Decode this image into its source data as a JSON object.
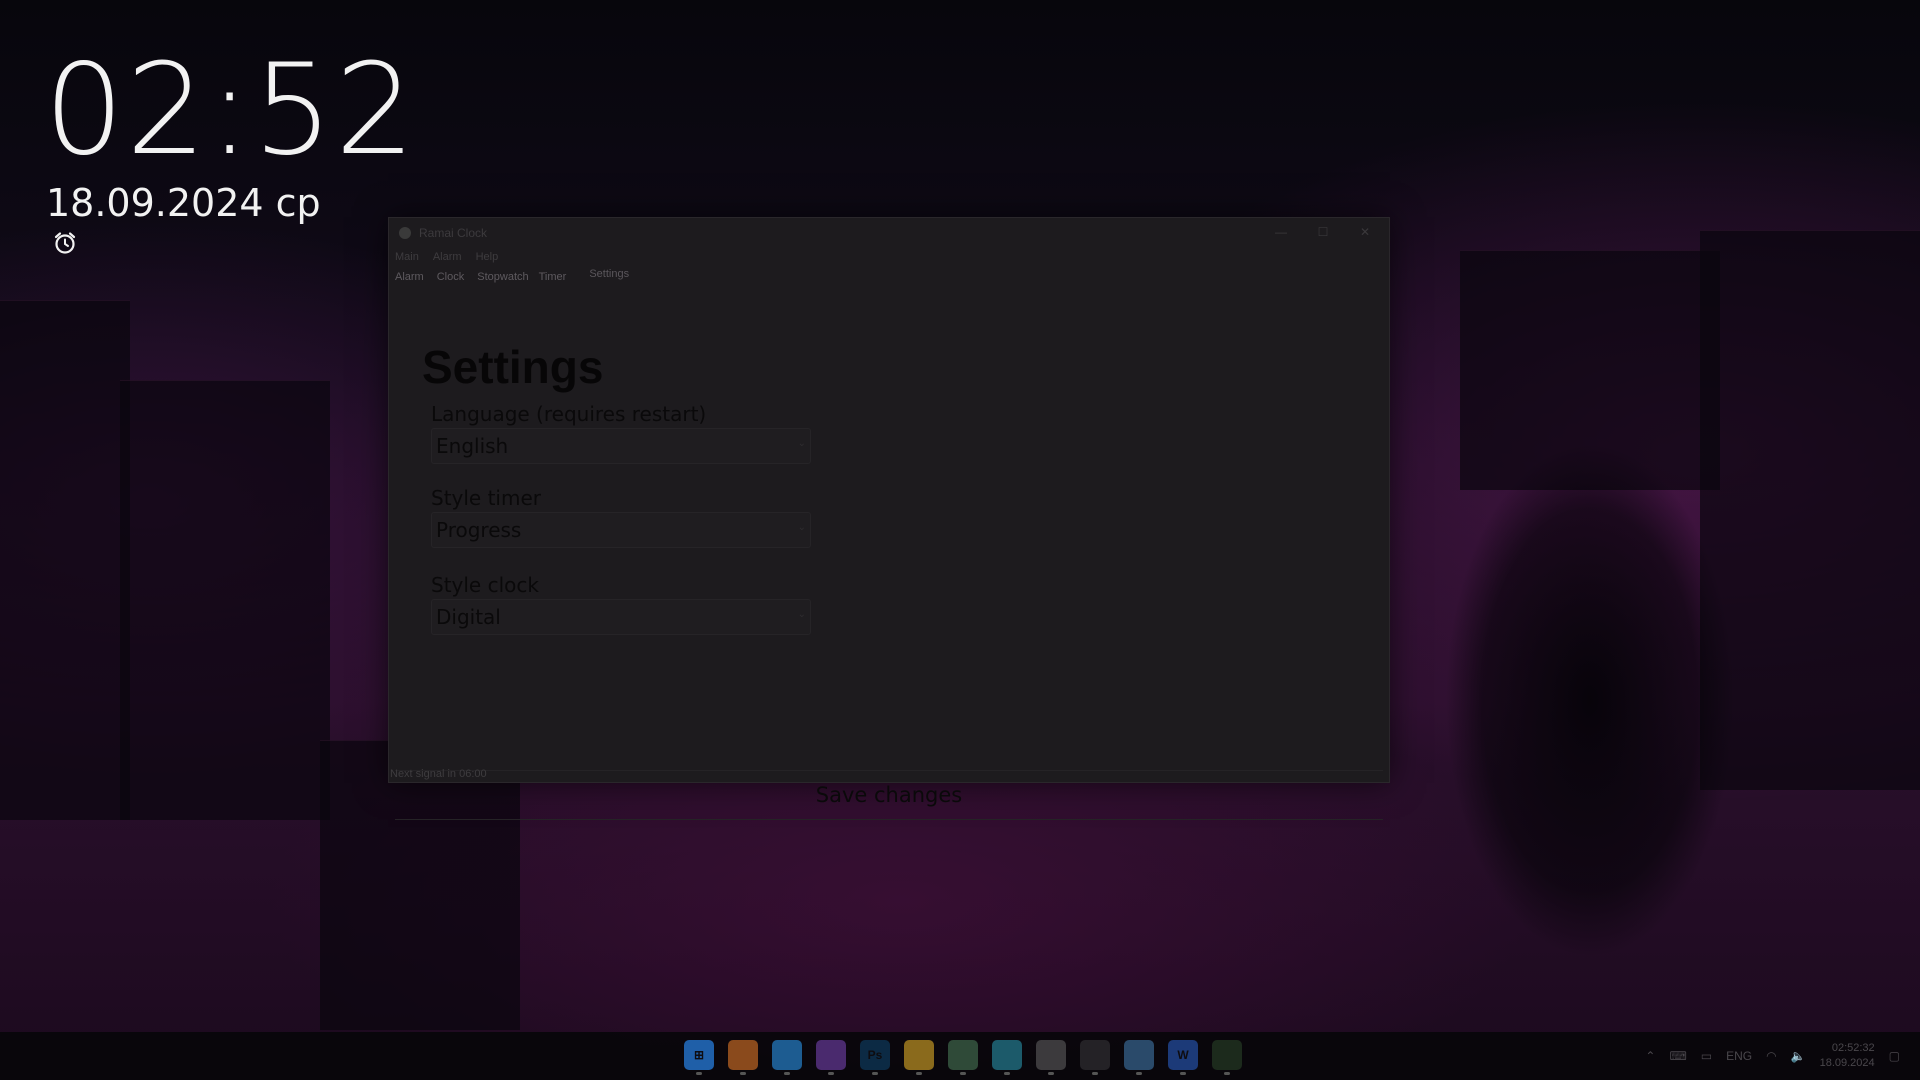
{
  "desktop": {
    "time": "02:52",
    "date": "18.09.2024 ср"
  },
  "window": {
    "title": "Ramai Clock",
    "controls": {
      "minimize": "—",
      "maximize": "☐",
      "close": "✕"
    },
    "menu": [
      "Main",
      "Alarm",
      "Help"
    ],
    "tabs": [
      "Alarm",
      "Clock",
      "Stopwatch",
      "Timer",
      "Settings"
    ],
    "active_tab": "Settings",
    "page_title": "Settings",
    "fields": {
      "language": {
        "label": "Language (requires restart)",
        "value": "English"
      },
      "style_timer": {
        "label": "Style timer",
        "value": "Progress"
      },
      "style_clock": {
        "label": "Style clock",
        "value": "Digital"
      }
    },
    "save_label": "Save changes",
    "status": "Next signal in 06:00"
  },
  "taskbar": {
    "apps": [
      {
        "name": "windows-start-icon",
        "color": "#1f5fa8",
        "glyph": "⊞"
      },
      {
        "name": "chrome-icon",
        "color": "#8a4a1c",
        "glyph": ""
      },
      {
        "name": "vscode-icon",
        "color": "#1d5c91",
        "glyph": ""
      },
      {
        "name": "visual-studio-icon",
        "color": "#4a2a6e",
        "glyph": ""
      },
      {
        "name": "photoshop-icon",
        "color": "#0c2a44",
        "glyph": "Ps"
      },
      {
        "name": "file-explorer-icon",
        "color": "#8a6a1c",
        "glyph": ""
      },
      {
        "name": "notes-app-icon",
        "color": "#2f4a38",
        "glyph": ""
      },
      {
        "name": "edge-icon",
        "color": "#1c5a6a",
        "glyph": ""
      },
      {
        "name": "calendar-app-icon",
        "color": "#3c3a3d",
        "glyph": ""
      },
      {
        "name": "clock-app-icon",
        "color": "#242226",
        "glyph": ""
      },
      {
        "name": "cloud-app-icon",
        "color": "#2a4a6a",
        "glyph": ""
      },
      {
        "name": "word-icon",
        "color": "#1c3a78",
        "glyph": "W"
      },
      {
        "name": "ramai-clock-taskbar-icon",
        "color": "#1c2a1c",
        "glyph": ""
      }
    ],
    "tray": {
      "language": "ENG",
      "time": "02:52:32",
      "date": "18.09.2024"
    }
  }
}
